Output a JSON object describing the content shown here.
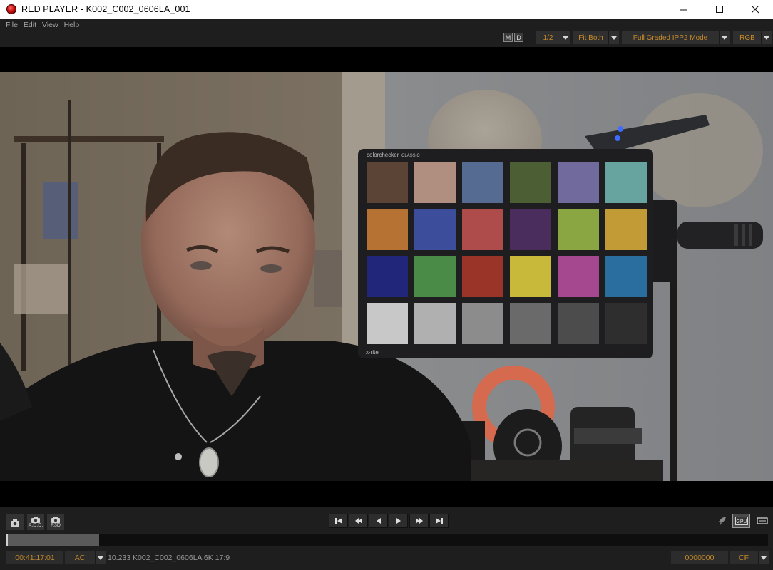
{
  "window": {
    "title": "RED PLAYER - K002_C002_0606LA_001",
    "controls": [
      "minimize",
      "maximize",
      "close"
    ]
  },
  "menu": [
    "File",
    "Edit",
    "View",
    "Help"
  ],
  "toolbar": {
    "monitor_m": "M",
    "monitor_d": "D",
    "resolution": "1/2",
    "fit_mode": "Fit Both",
    "color_mode": "Full Graded IPP2 Mode",
    "channel": "RGB"
  },
  "viewer": {
    "chart_brand": "colorchecker",
    "chart_variant": "CLASSIC",
    "chart_maker": "x·rite",
    "patches": [
      "#5b4436",
      "#b08e80",
      "#566b92",
      "#4b5e34",
      "#716b9d",
      "#67a39f",
      "#b67232",
      "#3b4d9b",
      "#ad4c4a",
      "#4a2d5c",
      "#8aa642",
      "#c29a36",
      "#21267a",
      "#4b8b48",
      "#9a3328",
      "#c8b93a",
      "#a54890",
      "#2a6ea0",
      "#c8c8c8",
      "#b0b0b0",
      "#8c8c8c",
      "#6a6a6a",
      "#4c4c4c",
      "#2e2e2e"
    ]
  },
  "transport": {
    "snapshot_labels": [
      "",
      "A.D.D.",
      "R3D"
    ],
    "buttons": [
      "go-to-start",
      "step-back-fast",
      "step-back",
      "play",
      "step-forward-fast",
      "go-to-end"
    ]
  },
  "timeline": {
    "progress_fraction": 0.122
  },
  "status": {
    "timecode": "00:41:17:01",
    "tc_mode": "AC",
    "clip_info": "10.233 K002_C002_0606LA 6K 17:9",
    "frame_number": "0000000",
    "frame_mode": "CF"
  },
  "right_tools": {
    "gpu_label": "GPU"
  }
}
